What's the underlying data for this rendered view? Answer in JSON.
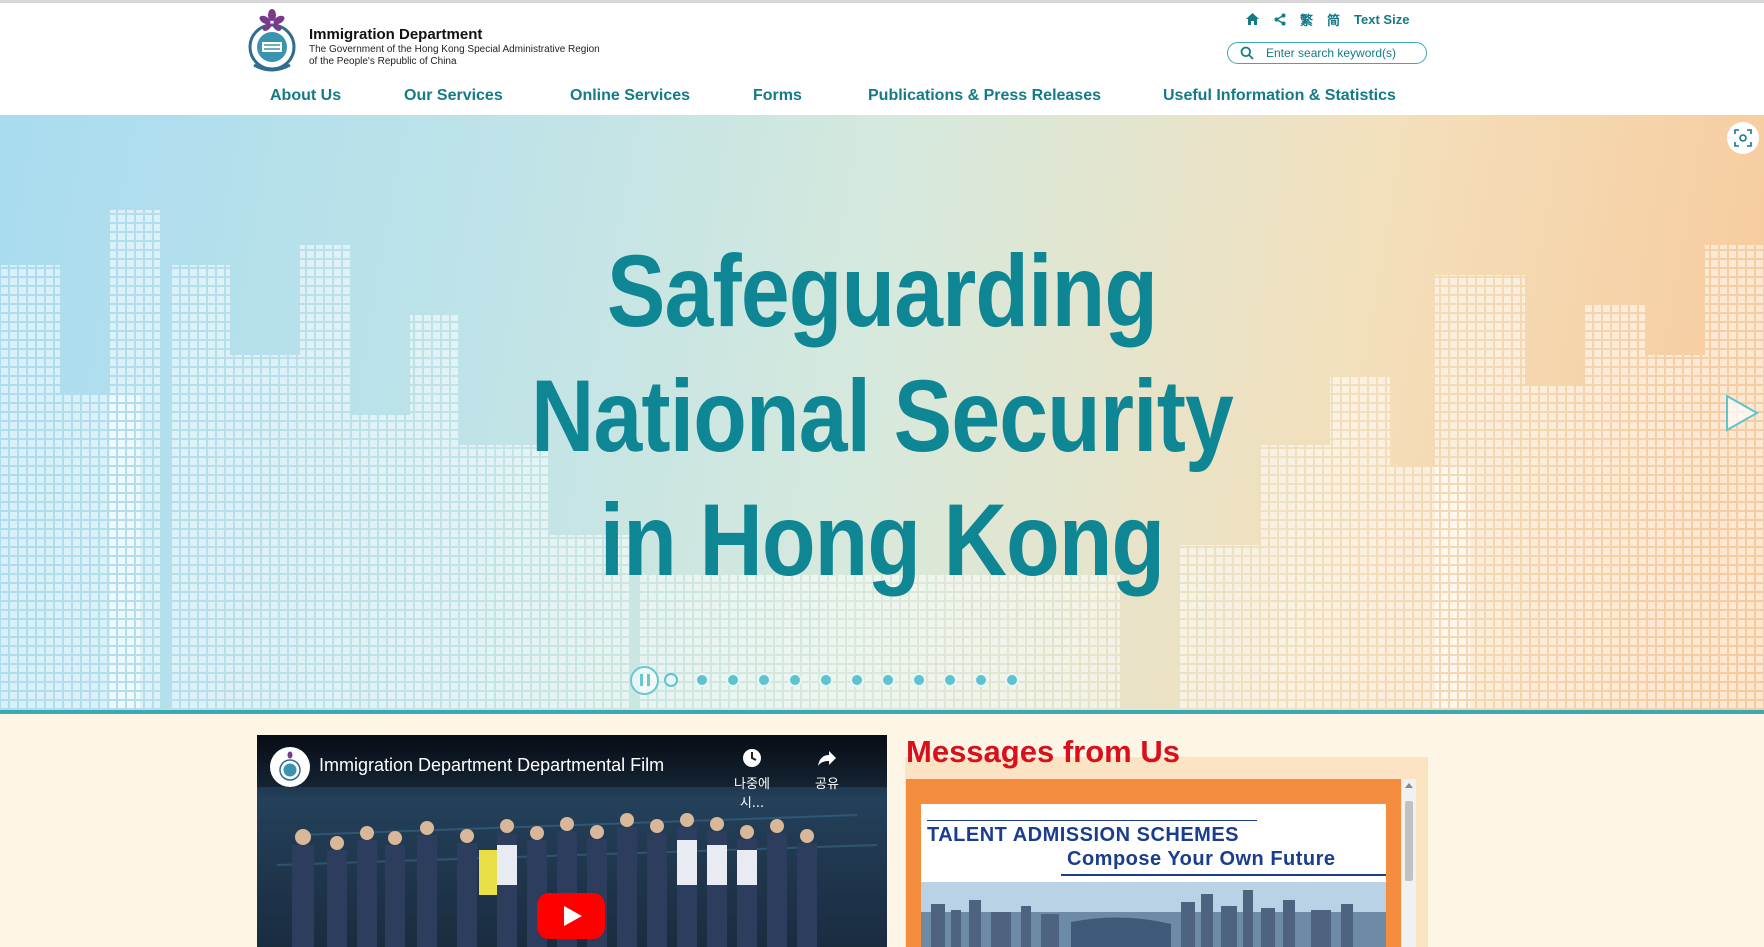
{
  "header": {
    "dept_name": "Immigration Department",
    "dept_sub_line1": "The Government of the Hong Kong Special Administrative Region",
    "dept_sub_line2": "of the People's Republic of China",
    "utility": {
      "home_icon": "home-icon",
      "share_icon": "share-icon",
      "traditional_chinese": "繁",
      "simplified_chinese": "简",
      "text_size": "Text Size"
    },
    "search": {
      "placeholder": "Enter search keyword(s)",
      "icon": "search-icon"
    }
  },
  "nav": {
    "items": [
      {
        "label": "About Us"
      },
      {
        "label": "Our Services"
      },
      {
        "label": "Online Services"
      },
      {
        "label": "Forms"
      },
      {
        "label": "Publications & Press Releases"
      },
      {
        "label": "Useful Information & Statistics"
      }
    ]
  },
  "banner": {
    "line1": "Safeguarding",
    "line2": "National Security",
    "line3": "in Hong Kong",
    "slide_count": 12,
    "active_slide": 1
  },
  "video": {
    "title": "Immigration Department Departmental Film",
    "watch_later_label": "나중에 시...",
    "share_label": "공유"
  },
  "messages": {
    "title": "Messages from Us",
    "card_line1": "TALENT ADMISSION SCHEMES",
    "card_line2": "Compose Your Own Future"
  },
  "colors": {
    "accent": "#137b88",
    "headline": "#0e8694",
    "messages_title": "#d90f19",
    "card_text": "#1a3d8f",
    "frame": "#f58d3f"
  }
}
